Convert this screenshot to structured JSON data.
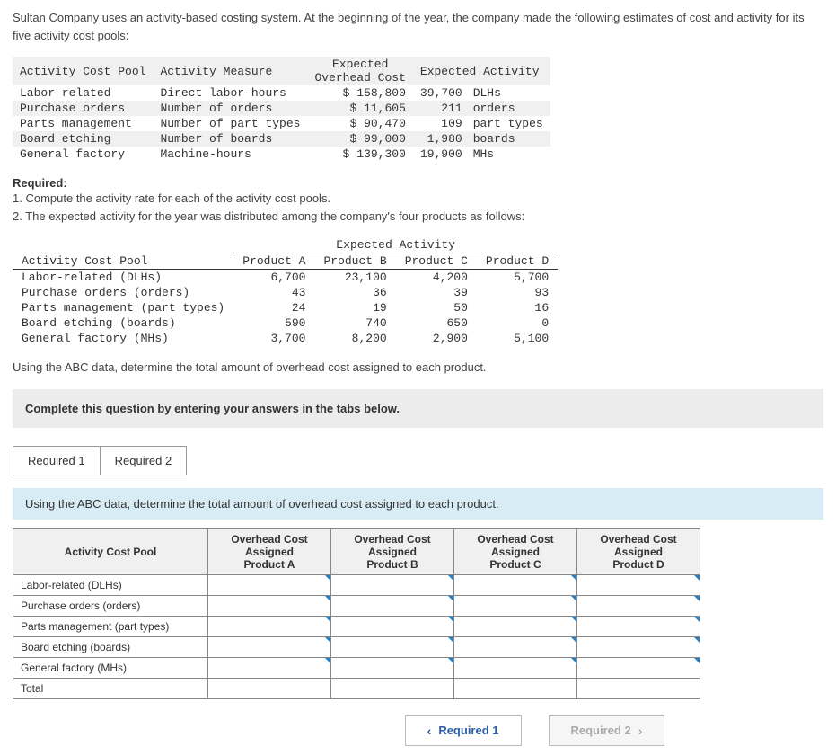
{
  "intro": "Sultan Company uses an activity-based costing system. At the beginning of the year, the company made the following estimates of cost and activity for its five activity cost pools:",
  "table1": {
    "headers": {
      "pool": "Activity Cost Pool",
      "measure": "Activity Measure",
      "cost": "Expected Overhead Cost",
      "activity": "Expected Activity"
    },
    "rows": [
      {
        "pool": "Labor-related",
        "measure": "Direct labor-hours",
        "cost": "$ 158,800",
        "qty": "39,700",
        "unit": "DLHs"
      },
      {
        "pool": "Purchase orders",
        "measure": "Number of orders",
        "cost": "$ 11,605",
        "qty": "211",
        "unit": "orders"
      },
      {
        "pool": "Parts management",
        "measure": "Number of part types",
        "cost": "$ 90,470",
        "qty": "109",
        "unit": "part types"
      },
      {
        "pool": "Board etching",
        "measure": "Number of boards",
        "cost": "$ 99,000",
        "qty": "1,980",
        "unit": "boards"
      },
      {
        "pool": "General factory",
        "measure": "Machine-hours",
        "cost": "$ 139,300",
        "qty": "19,900",
        "unit": "MHs"
      }
    ]
  },
  "required_label": "Required:",
  "required_items": {
    "r1": "1. Compute the activity rate for each of the activity cost pools.",
    "r2": "2. The expected activity for the year was distributed among the company's four products as follows:"
  },
  "table2": {
    "pool_header": "Activity Cost Pool",
    "group_header": "Expected Activity",
    "col_headers": {
      "a": "Product A",
      "b": "Product B",
      "c": "Product C",
      "d": "Product D"
    },
    "rows": [
      {
        "pool": "Labor-related (DLHs)",
        "a": "6,700",
        "b": "23,100",
        "c": "4,200",
        "d": "5,700"
      },
      {
        "pool": "Purchase orders (orders)",
        "a": "43",
        "b": "36",
        "c": "39",
        "d": "93"
      },
      {
        "pool": "Parts management (part types)",
        "a": "24",
        "b": "19",
        "c": "50",
        "d": "16"
      },
      {
        "pool": "Board etching (boards)",
        "a": "590",
        "b": "740",
        "c": "650",
        "d": "0"
      },
      {
        "pool": "General factory (MHs)",
        "a": "3,700",
        "b": "8,200",
        "c": "2,900",
        "d": "5,100"
      }
    ]
  },
  "abc_sentence": "Using the ABC data, determine the total amount of overhead cost assigned to each product.",
  "complete_bar": "Complete this question by entering your answers in the tabs below.",
  "tabs": {
    "t1": "Required 1",
    "t2": "Required 2"
  },
  "panel_instr": "Using the ABC data, determine the total amount of overhead cost assigned to each product.",
  "table3": {
    "col0": "Activity Cost Pool",
    "cols": {
      "a": "Overhead Cost Assigned Product A",
      "b": "Overhead Cost Assigned Product B",
      "c": "Overhead Cost Assigned Product C",
      "d": "Overhead Cost Assigned Product D"
    },
    "rows": [
      "Labor-related (DLHs)",
      "Purchase orders (orders)",
      "Parts management (part types)",
      "Board etching (boards)",
      "General factory (MHs)",
      "Total"
    ]
  },
  "nav": {
    "prev": "Required 1",
    "next": "Required 2"
  }
}
